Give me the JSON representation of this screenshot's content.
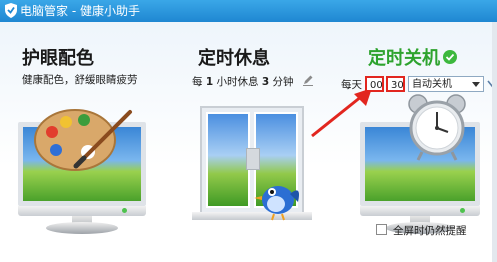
{
  "window": {
    "title": "电脑管家 - 健康小助手"
  },
  "eye_care": {
    "title": "护眼配色",
    "subtitle": "健康配色，舒缓眼睛疲劳"
  },
  "rest_timer": {
    "title": "定时休息",
    "text_prefix": "每",
    "hours": "1",
    "text_mid": "小时休息",
    "minutes": "3",
    "text_suffix": "分钟"
  },
  "shutdown": {
    "title": "定时关机",
    "status_icon": "check-icon",
    "daily_label": "每天",
    "hour_value": "00",
    "minute_value": "30",
    "mode_value": "自动关机"
  },
  "fullscreen_option": {
    "label": "全屏时仍然提醒",
    "checked": false
  },
  "colors": {
    "titlebar": "#1f87d2",
    "accent_green": "#2ea32e",
    "arrow_red": "#e2261f"
  }
}
